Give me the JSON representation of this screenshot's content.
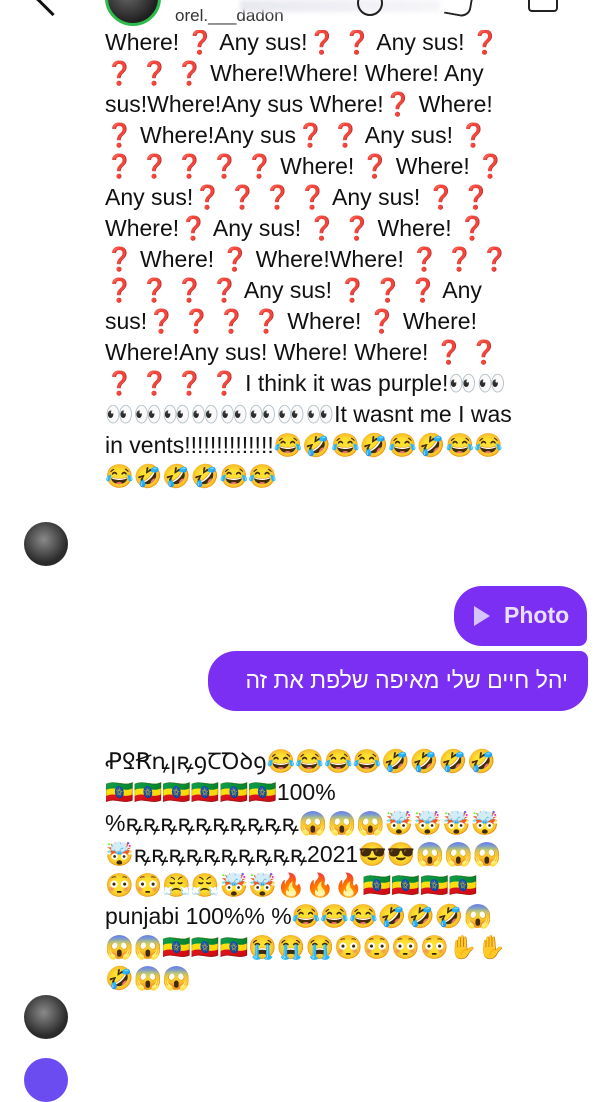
{
  "header": {
    "username": "orel.___dadon",
    "back_icon": "chevron-left-icon",
    "icons": [
      "emoji-icon",
      "phone-icon",
      "video-camera-icon"
    ]
  },
  "messages": [
    {
      "sender": "other",
      "text": "Where! ❓ Any sus!❓ ❓ Any sus! ❓ ❓ ❓ ❓ Where!Where! Where! Any sus!Where!Any sus Where!❓ Where! ❓ Where!Any sus❓ ❓ Any sus! ❓ ❓ ❓ ❓ ❓ ❓ Where! ❓ Where! ❓ Any sus!❓ ❓ ❓ ❓ Any sus! ❓ ❓ Where!❓ Any sus! ❓ ❓ Where! ❓ ❓ Where! ❓ Where!Where! ❓ ❓ ❓ ❓ ❓ ❓ ❓ Any sus! ❓ ❓ ❓ Any sus!❓ ❓ ❓ ❓ Where! ❓ Where! Where!Any sus! Where! Where! ❓ ❓ ❓ ❓ ❓ ❓ I think it was purple!👀👀👀👀👀👀👀👀👀👀It wasnt me I was in vents!!!!!!!!!!!!!!😂🤣😂🤣😂🤣😂😂😂🤣🤣🤣😂😂"
    },
    {
      "sender": "me",
      "type": "photo",
      "label": "Photo",
      "icon": "play-icon"
    },
    {
      "sender": "me",
      "text": "יהל חיים שלי מאיפה שלפת את זה"
    },
    {
      "sender": "other",
      "text": "ꝒꝾꞦꝴꞁꝶꝯꞆꝹꝺꝯ😂😂😂😂🤣🤣🤣🤣🇪🇹🇪🇹🇪🇹🇪🇹🇪🇹🇪🇹100% %ꝶꝶꝶꝶꝶꝶꝶꝶꝶꝶ😱😱😱🤯🤯🤯🤯🤯ꝶꝶꝶꝶꝶꝶꝶꝶꝶꝶ2021😎😎😱😱😱😳😳😤😤🤯🤯🔥🔥🔥🇪🇹🇪🇹🇪🇹🇪🇹 punjabi 100%% %😂😂😂🤣🤣🤣😱😱😱🇪🇹🇪🇹🇪🇹😭😭😭😳😳😳😳✋✋🤣😱😱"
    }
  ],
  "colors": {
    "sent_bubble": "#7b2ff2",
    "story_ring": "#2dbb4d"
  }
}
